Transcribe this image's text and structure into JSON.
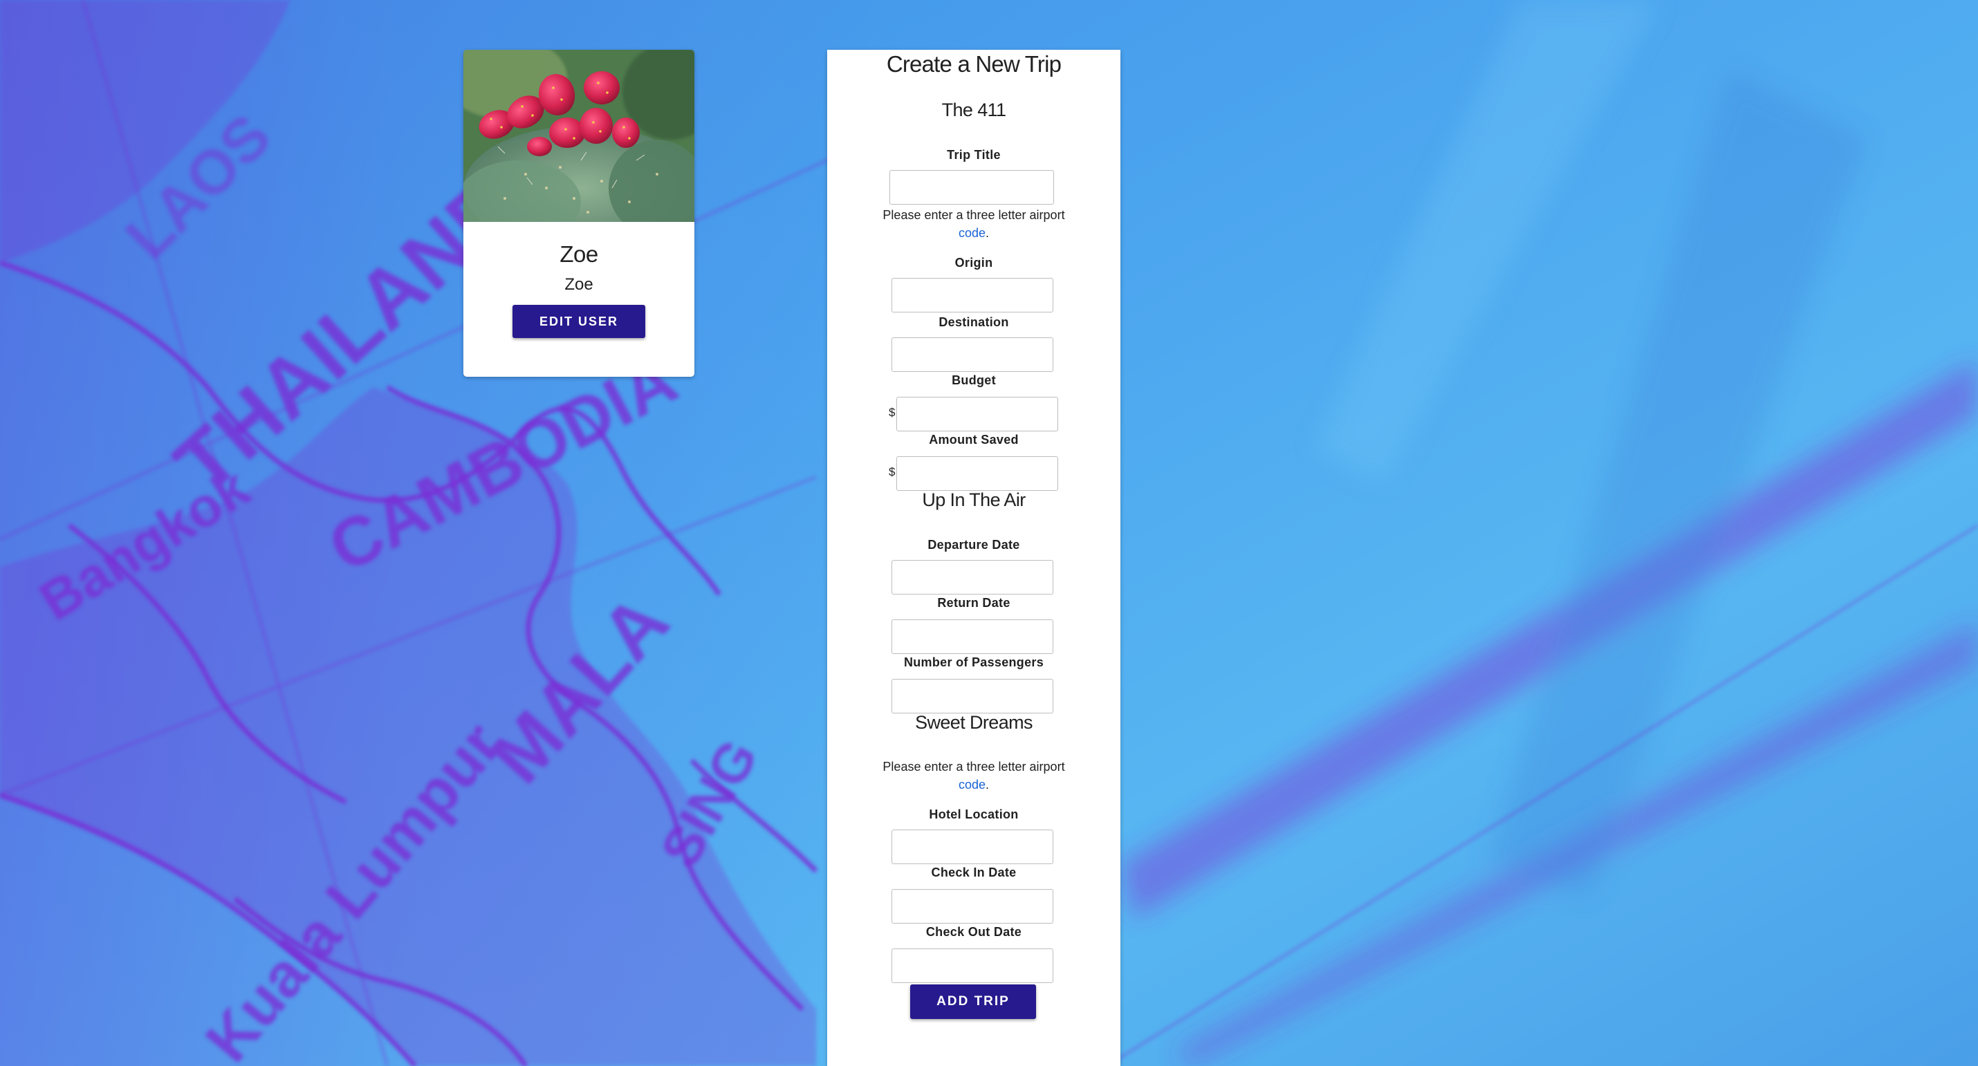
{
  "user": {
    "name": "Zoe",
    "username": "Zoe",
    "edit_label": "EDIT USER"
  },
  "form": {
    "title": "Create a New Trip",
    "sections": {
      "basics": "The 411",
      "flight": "Up In The Air",
      "hotel": "Sweet Dreams"
    },
    "help_text": "Please enter a three letter airport",
    "help_link": "code",
    "help_period": ".",
    "currency_symbol": "$",
    "labels": {
      "trip_title": "Trip Title",
      "origin": "Origin",
      "destination": "Destination",
      "budget": "Budget",
      "amount_saved": "Amount Saved",
      "departure_date": "Departure Date",
      "return_date": "Return Date",
      "passengers": "Number of Passengers",
      "hotel_location": "Hotel Location",
      "check_in": "Check In Date",
      "check_out": "Check Out Date"
    },
    "values": {
      "trip_title": "",
      "origin": "",
      "destination": "",
      "budget": "",
      "amount_saved": "",
      "departure_date": "",
      "return_date": "",
      "passengers": "",
      "hotel_location": "",
      "check_in": "",
      "check_out": ""
    },
    "submit_label": "ADD TRIP"
  },
  "colors": {
    "button": "#271a8e",
    "link": "#1a63d6",
    "background_blue": "#4fa8ee",
    "map_purple": "#7a2fd6"
  }
}
